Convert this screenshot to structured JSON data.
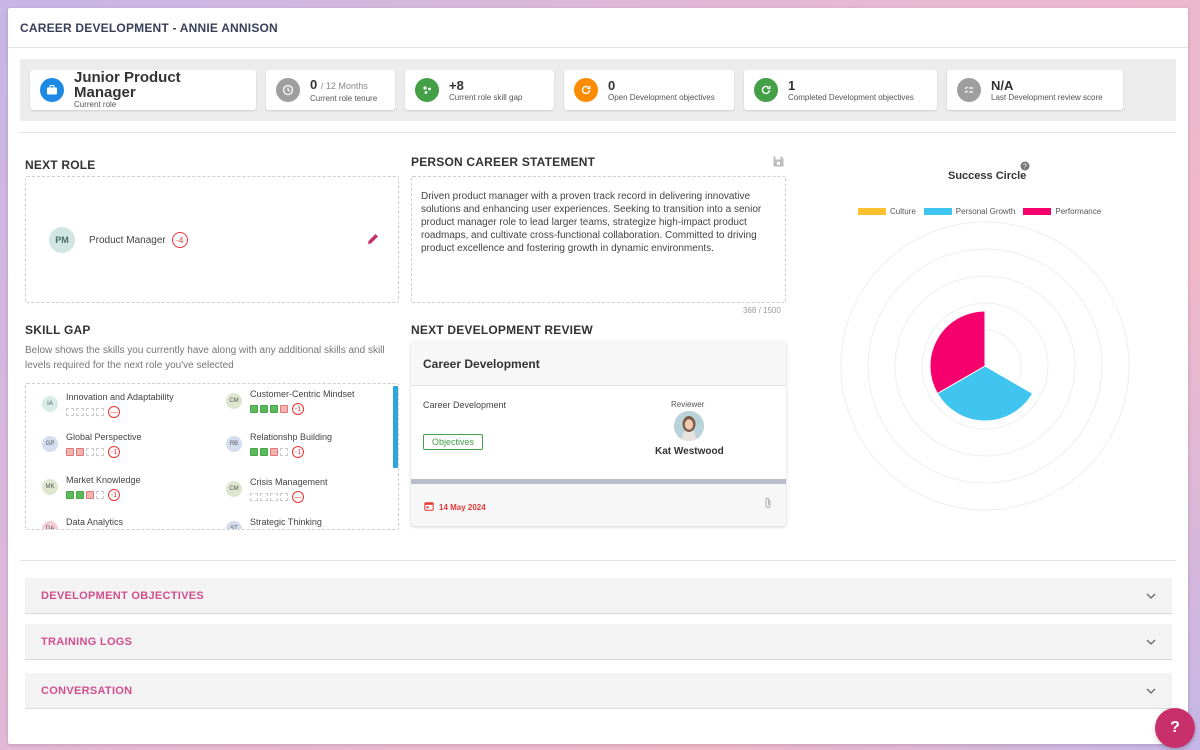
{
  "header": {
    "title": "CAREER DEVELOPMENT - ANNIE ANNISON"
  },
  "stats": [
    {
      "value": "Junior Product Manager",
      "sub": "",
      "label": "Current role",
      "icon": "briefcase-icon",
      "color": "#1e88e5"
    },
    {
      "value": "0",
      "sub": "/ 12 Months",
      "label": "Current role tenure",
      "icon": "clock-icon",
      "color": "#9e9e9e"
    },
    {
      "value": "+8",
      "sub": "",
      "label": "Current role skill gap",
      "icon": "molecule-icon",
      "color": "#43a047"
    },
    {
      "value": "0",
      "sub": "",
      "label": "Open Development objectives",
      "icon": "refresh-icon",
      "color": "#fb8c00"
    },
    {
      "value": "1",
      "sub": "",
      "label": "Completed Development objectives",
      "icon": "refresh-icon",
      "color": "#43a047"
    },
    {
      "value": "N/A",
      "sub": "",
      "label": "Last Development review score",
      "icon": "checklist-icon",
      "color": "#9e9e9e"
    }
  ],
  "next_role": {
    "title": "NEXT ROLE",
    "initials": "PM",
    "name": "Product Manager",
    "gap": "-4"
  },
  "statement": {
    "title": "PERSON CAREER STATEMENT",
    "text": "Driven product manager with a proven track record in delivering innovative solutions and enhancing user experiences. Seeking to transition into a senior product manager role to lead larger teams, strategize high-impact product roadmaps, and cultivate cross-functional collaboration. Committed to driving product excellence and fostering growth in dynamic environments.",
    "count": "368 / 1500"
  },
  "skill_gap": {
    "title": "SKILL GAP",
    "description": "Below shows the skills you currently have along with any additional skills and skill levels required for the next role you've selected",
    "skills": [
      {
        "initials": "IA",
        "name": "Innovation and Adaptability",
        "boxes": "dddd",
        "gap": "—",
        "color": "#d5ede6"
      },
      {
        "initials": "CM",
        "name": "Customer-Centric Mindset",
        "boxes": "gggr",
        "gap": "-1",
        "color": "#dfe6cf"
      },
      {
        "initials": "GP",
        "name": "Global Perspective",
        "boxes": "rrdd",
        "gap": "-1",
        "color": "#d4dcef"
      },
      {
        "initials": "RB",
        "name": "Relationshp Building",
        "boxes": "ggrd",
        "gap": "-1",
        "color": "#d4dcef"
      },
      {
        "initials": "MK",
        "name": "Market Knowledge",
        "boxes": "ggrd",
        "gap": "-1",
        "color": "#dfe6cf"
      },
      {
        "initials": "CM",
        "name": "Crisis Management",
        "boxes": "dddd",
        "gap": "—",
        "color": "#dfe6cf"
      },
      {
        "initials": "DA",
        "name": "Data Analytics",
        "boxes": "",
        "gap": "",
        "color": "#f3ccd6"
      },
      {
        "initials": "ST",
        "name": "Strategic Thinking",
        "boxes": "",
        "gap": "",
        "color": "#d4dcef"
      }
    ]
  },
  "review": {
    "section_title": "NEXT DEVELOPMENT REVIEW",
    "card_title": "Career Development",
    "item_label": "Career Development",
    "objectives_label": "Objectives",
    "reviewer_label": "Reviewer",
    "reviewer_name": "Kat Westwood",
    "date": "14 May 2024"
  },
  "success_circle": {
    "title": "Success Circle",
    "legend": [
      {
        "name": "Culture",
        "color": "#fbc02d"
      },
      {
        "name": "Personal Growth",
        "color": "#3fc5f0"
      },
      {
        "name": "Performance",
        "color": "#f5006d"
      }
    ]
  },
  "chart_data": {
    "type": "pie",
    "title": "Success Circle",
    "series": [
      {
        "name": "Culture",
        "value": 0
      },
      {
        "name": "Personal Growth",
        "value": 1
      },
      {
        "name": "Performance",
        "value": 1
      }
    ],
    "legend_position": "top"
  },
  "accordions": [
    {
      "label": "DEVELOPMENT OBJECTIVES"
    },
    {
      "label": "TRAINING LOGS"
    },
    {
      "label": "CONVERSATION"
    }
  ],
  "help": {
    "label": "?"
  }
}
